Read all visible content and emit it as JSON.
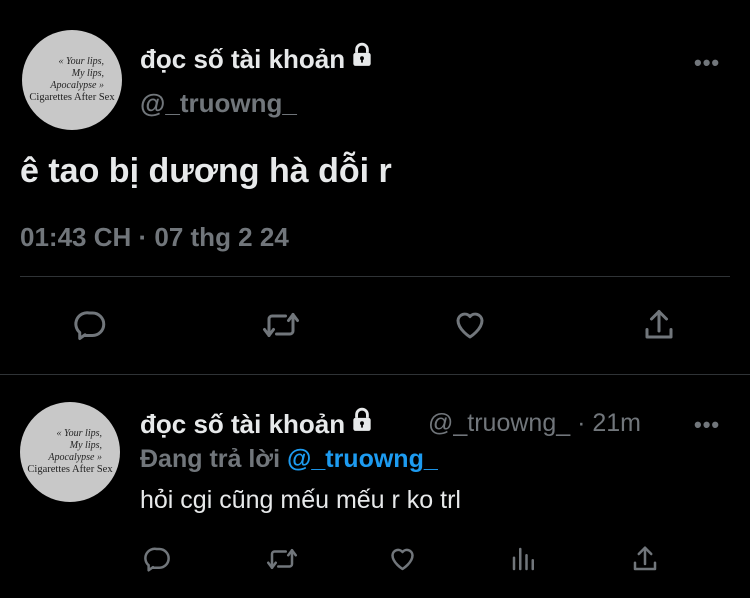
{
  "main_tweet": {
    "avatar_lines": [
      "« Your lips,",
      "My lips,",
      "Apocalypse »",
      "Cigarettes After Sex"
    ],
    "display_name": "đọc số tài khoản",
    "handle": "@_truowng_",
    "text": "ê tao bị dương hà dỗi r",
    "timestamp": "01:43 CH · 07 thg 2 24",
    "actions": [
      "reply-icon",
      "retweet-icon",
      "like-icon",
      "share-icon"
    ]
  },
  "reply_tweet": {
    "avatar_lines": [
      "« Your lips,",
      "My lips,",
      "Apocalypse »",
      "Cigarettes After Sex"
    ],
    "display_name": "đọc số tài khoản",
    "handle": "@_truowng_",
    "time": "· 21m",
    "replying_prefix": "Đang trả lời",
    "replying_to": "@_truowng_",
    "text": "hỏi cgi cũng mếu mếu r ko trl",
    "actions": [
      "reply-icon",
      "retweet-icon",
      "like-icon",
      "views-icon",
      "share-icon"
    ]
  },
  "colors": {
    "background": "#000000",
    "text": "#e7e9ea",
    "muted": "#71767b",
    "accent": "#1d9bf0",
    "divider": "#2f3336"
  }
}
